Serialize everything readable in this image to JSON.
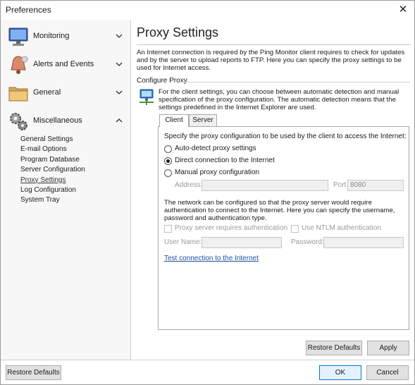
{
  "window": {
    "title": "Preferences"
  },
  "sidebar": {
    "groups": [
      {
        "label": "Monitoring",
        "icon": "monitor-icon",
        "expanded": false
      },
      {
        "label": "Alerts and Events",
        "icon": "bell-icon",
        "expanded": false
      },
      {
        "label": "General",
        "icon": "folder-icon",
        "expanded": false
      },
      {
        "label": "Miscellaneous",
        "icon": "gears-icon",
        "expanded": true
      }
    ],
    "items": [
      {
        "label": "General Settings"
      },
      {
        "label": "E-mail Options"
      },
      {
        "label": "Program Database"
      },
      {
        "label": "Server Configuration"
      },
      {
        "label": "Proxy Settings",
        "active": true
      },
      {
        "label": "Log Configuration"
      },
      {
        "label": "System Tray"
      }
    ]
  },
  "main": {
    "title": "Proxy Settings",
    "intro": "An Internet connection is required by the Ping Monitor client requires to check for updates and by the server to upload reports to FTP. Here you can specify the proxy settings to be used for Internet access.",
    "section": "Configure Proxy",
    "description": "For the client settings, you can choose between automatic detection and manual specification of the proxy configuration. The automatic detection means that the settings predefined in the Internet Explorer are used.",
    "tabs": [
      {
        "label": "Client",
        "active": true
      },
      {
        "label": "Server",
        "active": false
      }
    ],
    "client": {
      "instruction": "Specify the proxy configuration to be used by the client to access the Internet:",
      "options": [
        {
          "label": "Auto-detect proxy settings",
          "checked": false
        },
        {
          "label": "Direct connection to the Internet",
          "checked": true
        },
        {
          "label": "Manual proxy configuration",
          "checked": false
        }
      ],
      "address_label": "Address:",
      "address_value": "",
      "port_label": "Port",
      "port_value": "8080",
      "auth_note": "The network can be configured so that the proxy server would require authentication to connect to the Internet. Here you can specify the username, password and authentication type.",
      "auth_checkbox": "Proxy server requires authentication",
      "ntlm_checkbox": "Use NTLM authentication",
      "username_label": "User Name:",
      "password_label": "Password:",
      "test_link": "Test connection to the Internet"
    },
    "restore_defaults": "Restore Defaults",
    "apply": "Apply"
  },
  "footer": {
    "restore_defaults": "Restore Defaults",
    "ok": "OK",
    "cancel": "Cancel"
  },
  "colors": {
    "accent": "#0078d7",
    "link": "#1a4f9c",
    "sidebar_bg": "#f7f7f7"
  }
}
